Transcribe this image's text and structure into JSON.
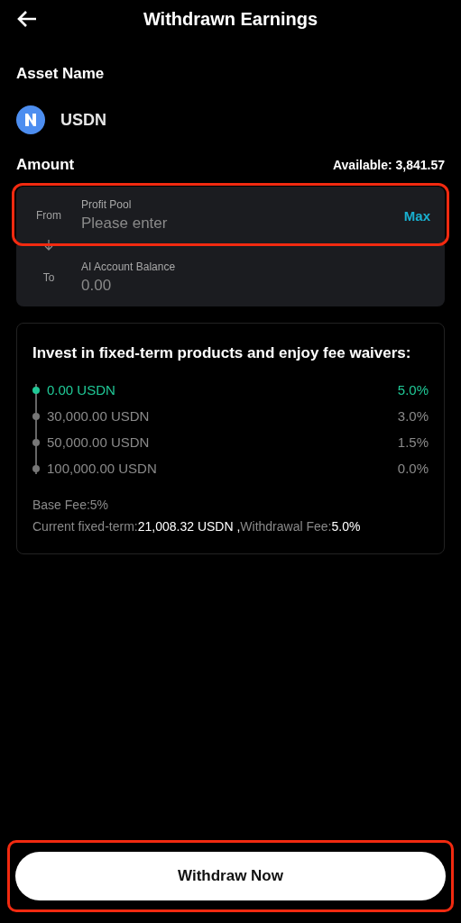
{
  "header": {
    "title": "Withdrawn Earnings"
  },
  "asset": {
    "label": "Asset Name",
    "name": "USDN"
  },
  "amount": {
    "label": "Amount",
    "available": "Available: 3,841.57"
  },
  "transfer": {
    "from": {
      "side": "From",
      "account": "Profit Pool",
      "placeholder": "Please enter",
      "max": "Max",
      "highlighted": true
    },
    "to": {
      "side": "To",
      "account": "AI Account Balance",
      "value": "0.00"
    }
  },
  "promo": {
    "title": "Invest in fixed-term products and enjoy fee waivers:",
    "tiers": [
      {
        "amount": "0.00 USDN",
        "fee": "5.0%",
        "selected": true
      },
      {
        "amount": "30,000.00 USDN",
        "fee": "3.0%",
        "selected": false
      },
      {
        "amount": "50,000.00 USDN",
        "fee": "1.5%",
        "selected": false
      },
      {
        "amount": "100,000.00 USDN",
        "fee": "0.0%",
        "selected": false
      }
    ],
    "base_fee": "Base Fee:5%",
    "current": "Current fixed-term:**21,008.32 USDN ,**Withdrawal Fee:**5.0%**"
  },
  "submit": {
    "label": "Withdraw Now",
    "highlighted": true
  }
}
